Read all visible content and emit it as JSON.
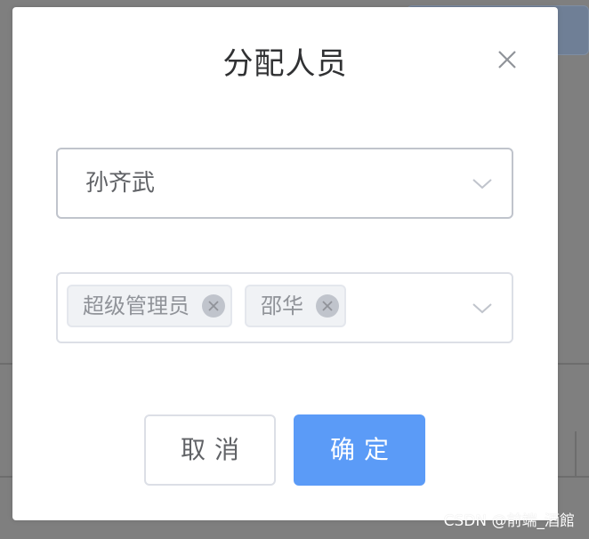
{
  "dialog": {
    "title": "分配人员",
    "close_icon": "close-icon"
  },
  "user_select": {
    "value": "孙齐武",
    "icon": "chevron-down-icon"
  },
  "role_select": {
    "tags": [
      {
        "label": "超级管理员"
      },
      {
        "label": "邵华"
      }
    ],
    "icon": "chevron-down-icon"
  },
  "footer": {
    "cancel_label": "取消",
    "confirm_label": "确定"
  },
  "watermark": "CSDN @前端_酒館",
  "colors": {
    "primary": "#5b9bf7",
    "overlay": "#7f7f7f",
    "border": "#c0c4cc",
    "tag_bg": "#f0f2f5"
  }
}
